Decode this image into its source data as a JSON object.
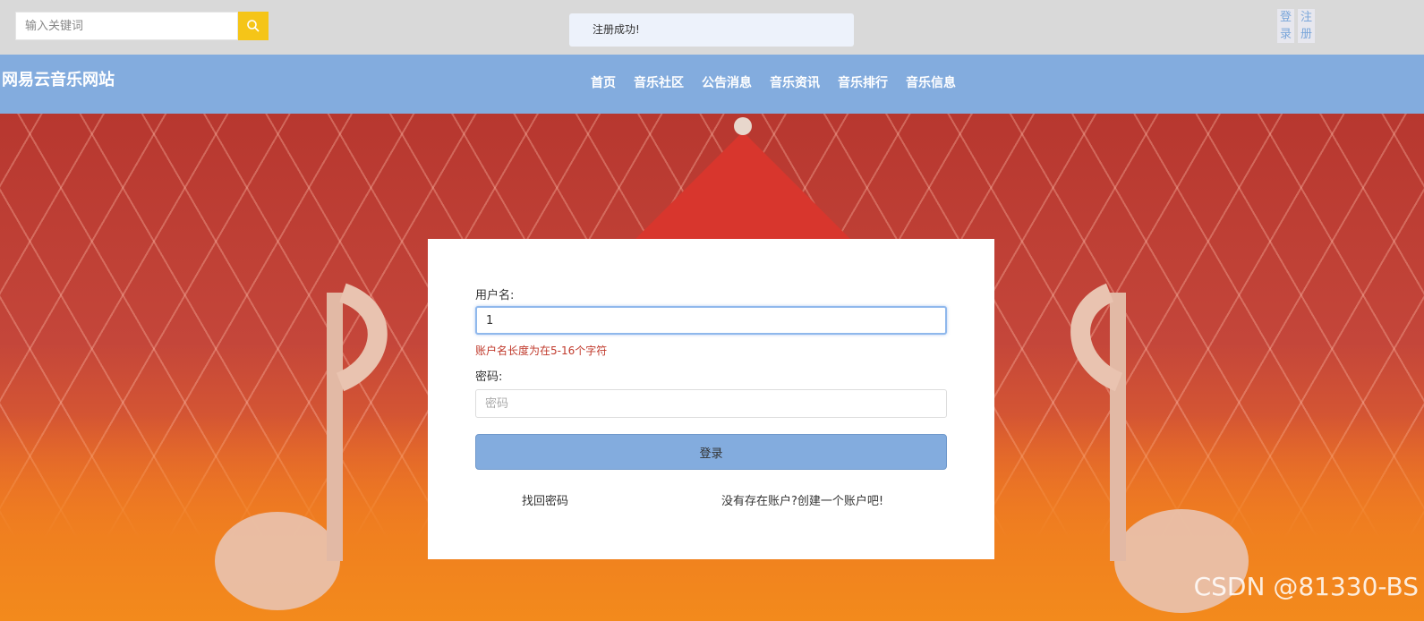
{
  "search": {
    "placeholder": "输入关键词",
    "icon": "search-icon",
    "button_color": "#f5c518"
  },
  "toast": {
    "message": "注册成功!"
  },
  "auth": {
    "login": "登录",
    "register": "注册"
  },
  "brand": {
    "title": "网易云音乐网站"
  },
  "nav": {
    "items": [
      "首页",
      "音乐社区",
      "公告消息",
      "音乐资讯",
      "音乐排行",
      "音乐信息"
    ],
    "bg_color": "#83acde"
  },
  "login": {
    "username_label": "用户名:",
    "username_value": "1",
    "username_error": "账户名长度为在5-16个字符",
    "password_label": "密码:",
    "password_placeholder": "密码",
    "submit_label": "登录",
    "forgot_link": "找回密码",
    "register_link": "没有存在账户?创建一个账户吧!"
  },
  "watermark": "CSDN @81330-BS"
}
